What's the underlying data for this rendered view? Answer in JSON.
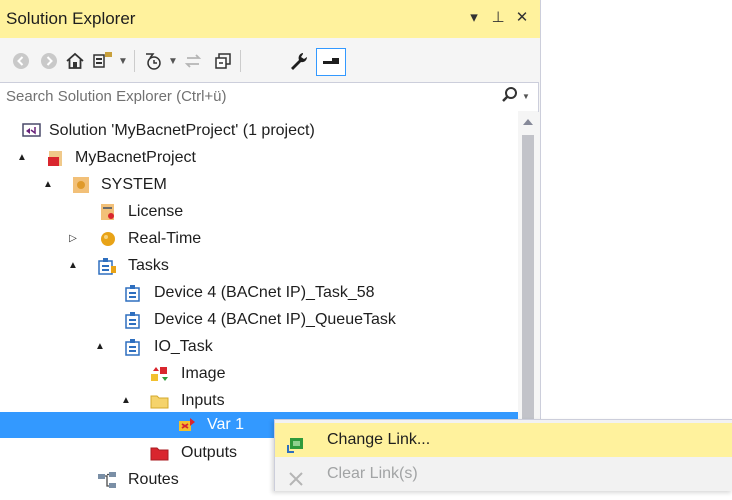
{
  "window": {
    "title": "Solution Explorer",
    "buttons": [
      "▾",
      "⊥",
      "✕"
    ]
  },
  "toolbar": {
    "icons": [
      "back-icon",
      "forward-icon",
      "home-icon",
      "switch-views-icon",
      "pending-changes-filter-icon",
      "sync-icon",
      "collapse-all-icon",
      "properties-wrench-icon",
      "preview-icon"
    ]
  },
  "search": {
    "placeholder": "Search Solution Explorer (Ctrl+ü)"
  },
  "tree": {
    "items": [
      {
        "label": "Solution 'MyBacnetProject' (1 project)",
        "icon": "solution-icon"
      },
      {
        "label": "MyBacnetProject",
        "icon": "project-icon",
        "expander": "▲"
      },
      {
        "label": "SYSTEM",
        "icon": "system-icon",
        "expander": "▲"
      },
      {
        "label": "License",
        "icon": "license-icon"
      },
      {
        "label": "Real-Time",
        "icon": "realtime-icon",
        "expander": "▷"
      },
      {
        "label": "Tasks",
        "icon": "tasks-icon",
        "expander": "▲"
      },
      {
        "label": "Device 4 (BACnet IP)_Task_58",
        "icon": "task-icon"
      },
      {
        "label": "Device 4 (BACnet IP)_QueueTask",
        "icon": "task-icon"
      },
      {
        "label": "IO_Task",
        "icon": "task-icon",
        "expander": "▲"
      },
      {
        "label": "Image",
        "icon": "image-icon"
      },
      {
        "label": "Inputs",
        "icon": "folder-icon",
        "expander": "▲"
      },
      {
        "label": "Var 1",
        "icon": "variable-icon",
        "selected": true
      },
      {
        "label": "Outputs",
        "icon": "outputs-folder-icon"
      },
      {
        "label": "Routes",
        "icon": "routes-icon"
      }
    ]
  },
  "context_menu": {
    "items": [
      {
        "label": "Change Link...",
        "icon": "change-link-icon",
        "enabled": true,
        "highlighted": true
      },
      {
        "label": "Clear Link(s)",
        "icon": "clear-link-icon",
        "enabled": false
      }
    ]
  },
  "colors": {
    "title_bar": "#fff29d",
    "selection": "#3399ff",
    "menu_highlight": "#fff29d"
  }
}
